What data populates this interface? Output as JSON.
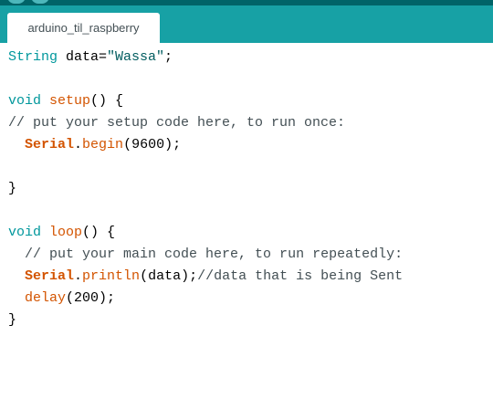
{
  "colors": {
    "header_dark": "#006468",
    "tab_bar": "#17a1a5",
    "tab_active": "#ffffff",
    "keyword_type": "#00979c",
    "keyword_func": "#d35400",
    "string": "#005c5f",
    "comment": "#434f54"
  },
  "tabs": [
    {
      "label": "arduino_til_raspberry"
    }
  ],
  "code": {
    "line1": {
      "type": "String",
      "rest": " data=",
      "str": "\"Wassa\"",
      "end": ";"
    },
    "line3": {
      "type": "void",
      "sp": " ",
      "func": "setup",
      "rest": "() {"
    },
    "line4": {
      "comment": "// put your setup code here, to run once:"
    },
    "line5": {
      "indent": "  ",
      "cls": "Serial",
      "dot": ".",
      "func": "begin",
      "rest": "(9600);"
    },
    "line7": {
      "text": "}"
    },
    "line9": {
      "type": "void",
      "sp": " ",
      "func": "loop",
      "rest": "() {"
    },
    "line10": {
      "indent": "  ",
      "comment": "// put your main code here, to run repeatedly:"
    },
    "line11": {
      "indent": "  ",
      "cls": "Serial",
      "dot": ".",
      "func": "println",
      "rest": "(data);",
      "comment": "//data that is being Sent"
    },
    "line12": {
      "indent": "  ",
      "func": "delay",
      "rest": "(200);"
    },
    "line13": {
      "text": "}"
    }
  }
}
